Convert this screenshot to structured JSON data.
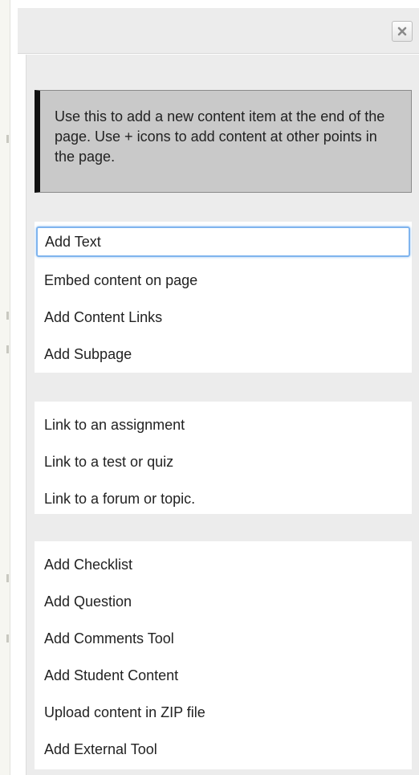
{
  "dialog": {
    "close_icon": "close-x-icon",
    "info_text": "Use this to add a new content item at the end of the page. Use + icons to add content at other points in the page."
  },
  "groups": [
    {
      "items": [
        {
          "label": "Add Text",
          "focused": true
        },
        {
          "label": "Embed content on page"
        },
        {
          "label": "Add Content Links"
        },
        {
          "label": "Add Subpage"
        }
      ]
    },
    {
      "items": [
        {
          "label": "Link to an assignment"
        },
        {
          "label": "Link to a test or quiz"
        },
        {
          "label": "Link to a forum or topic."
        }
      ]
    },
    {
      "items": [
        {
          "label": "Add Checklist"
        },
        {
          "label": "Add Question"
        },
        {
          "label": "Add Comments Tool"
        },
        {
          "label": "Add Student Content"
        },
        {
          "label": "Upload content in ZIP file"
        },
        {
          "label": "Add External Tool"
        }
      ]
    }
  ],
  "colors": {
    "focus_ring": "#7fb4ee",
    "info_box_bg": "#c9c9c9",
    "info_box_accent": "#111111",
    "panel_bg": "#ececec"
  }
}
